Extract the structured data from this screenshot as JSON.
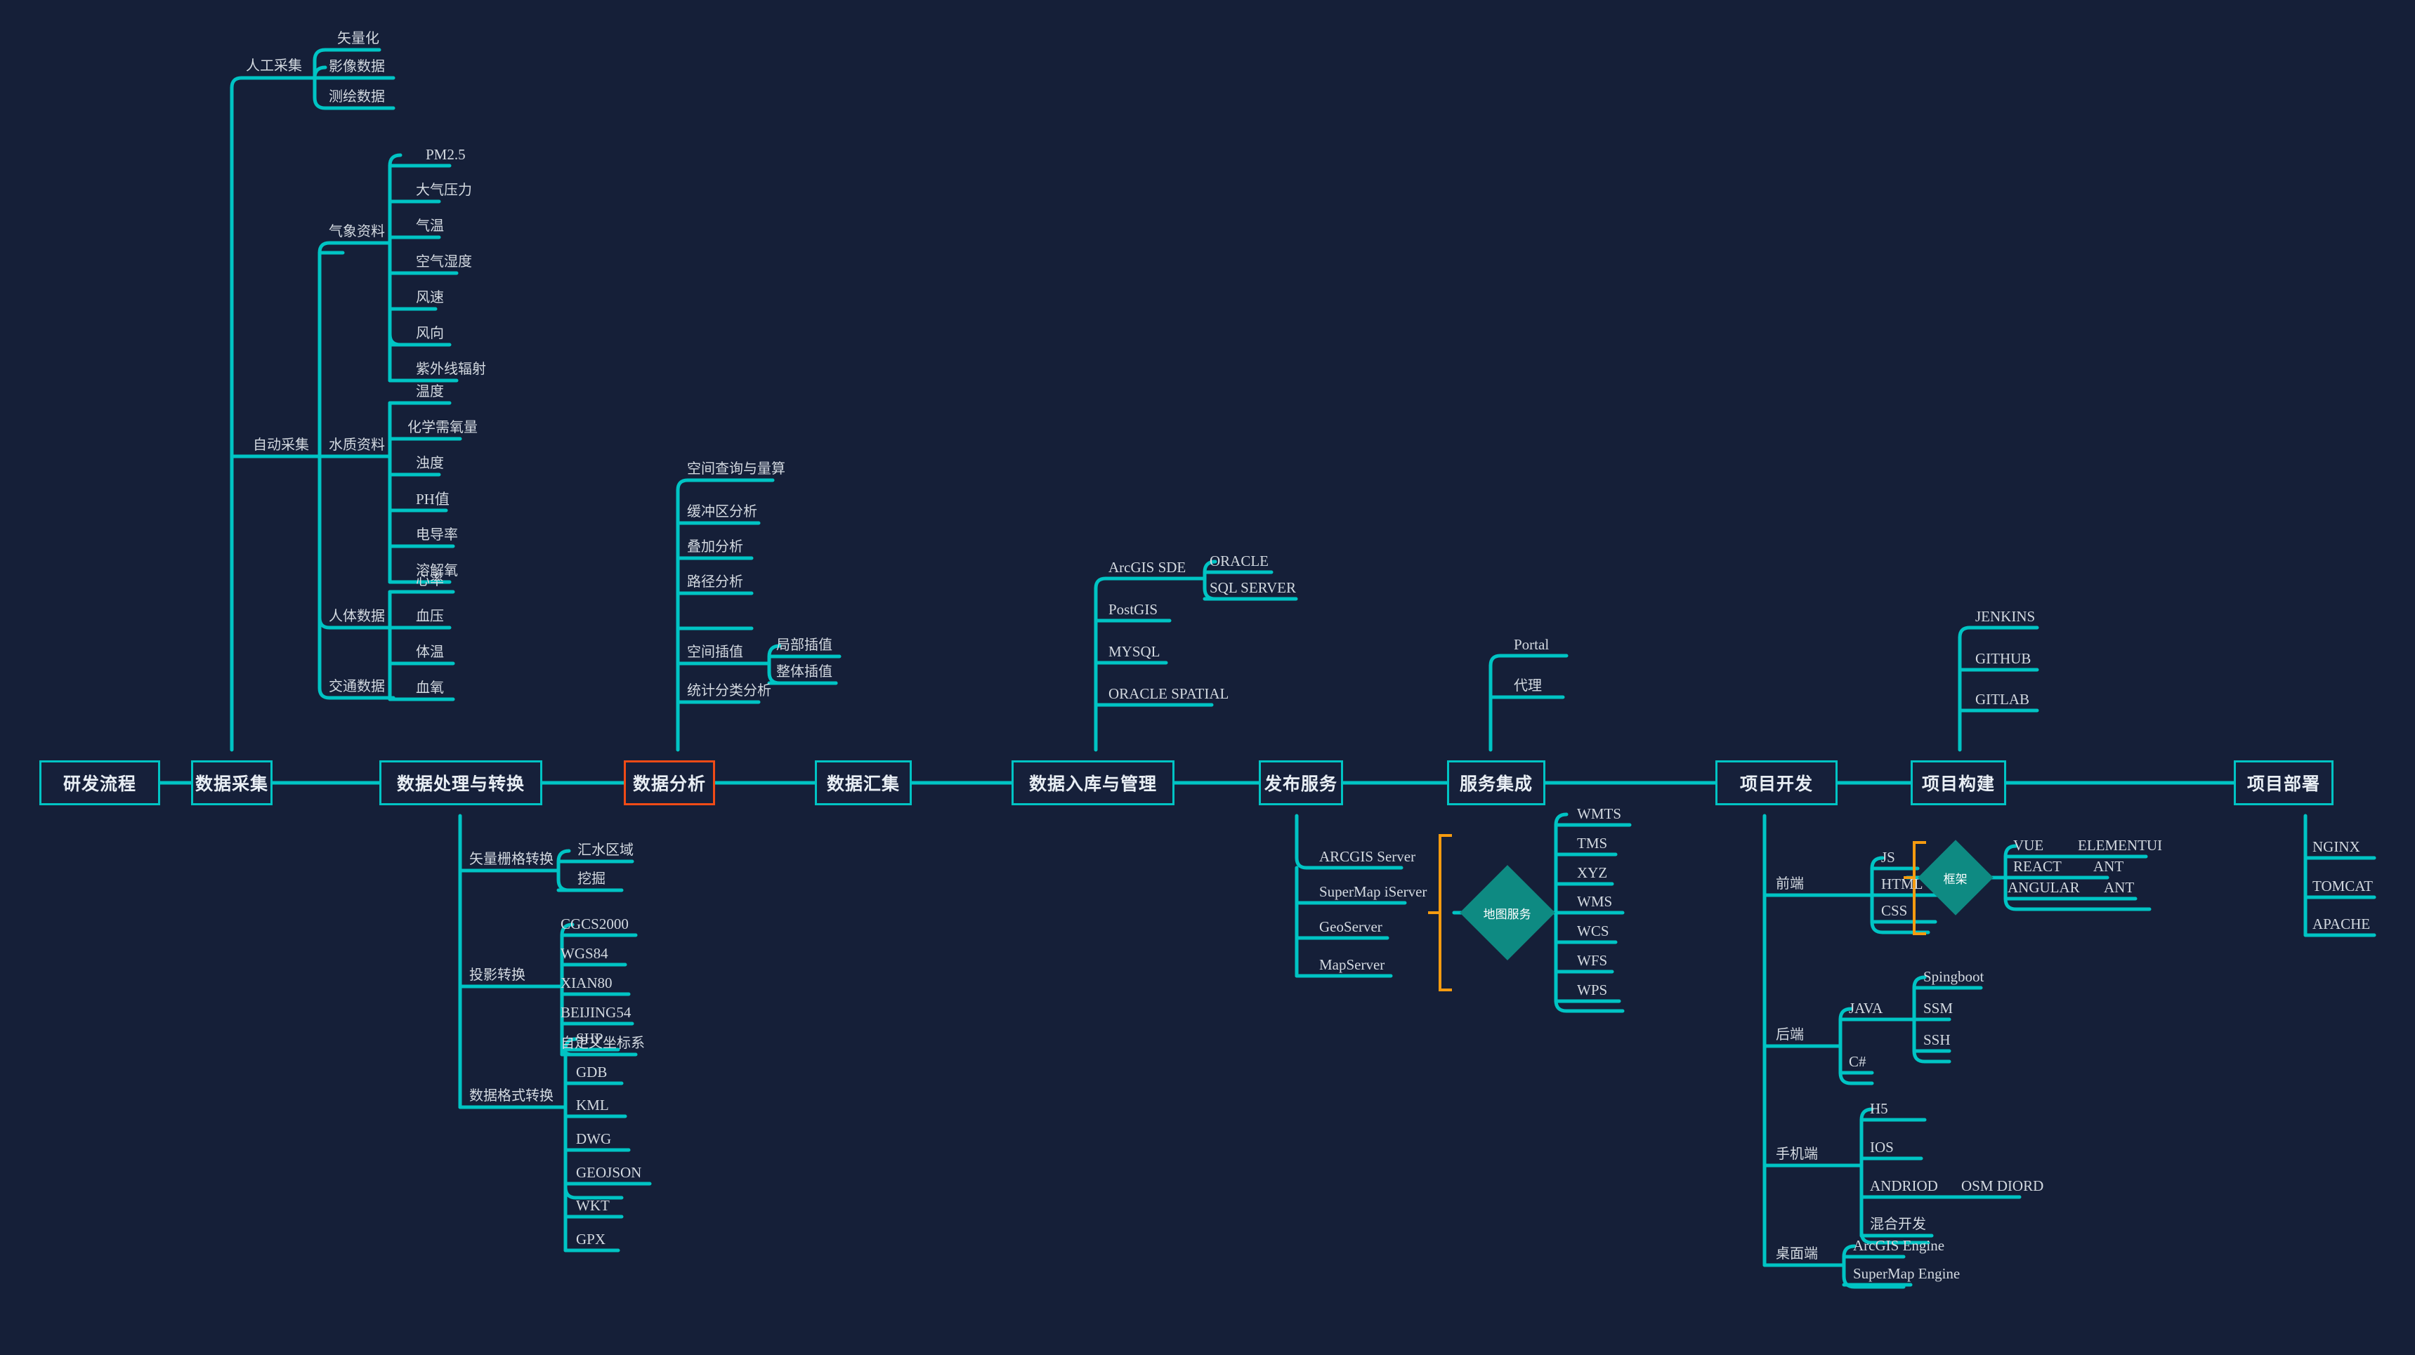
{
  "theme": {
    "background": "#151f38",
    "line": "#00c4c4",
    "line_alt": "#12b2ae",
    "accent": "#f04b16",
    "bracket": "#f59b10",
    "diamond_fill": "#0e8a82",
    "text": "#d3d9e0"
  },
  "spine": {
    "title": "研发流程",
    "stages": [
      "数据采集",
      "数据处理与转换",
      "数据分析",
      "数据汇集",
      "数据入库与管理",
      "发布服务",
      "服务集成",
      "项目开发",
      "项目构建",
      "项目部署"
    ],
    "highlighted": "数据分析"
  },
  "branches": {
    "data_collection": {
      "label": "数据采集",
      "children": [
        {
          "label": "人工采集",
          "children": [
            "矢量化",
            "影像数据",
            "测绘数据"
          ]
        },
        {
          "label": "自动采集",
          "children": [
            {
              "label": "气象资料",
              "children": [
                "PM2.5",
                "大气压力",
                "气温",
                "空气湿度",
                "风速",
                "风向",
                "紫外线辐射"
              ]
            },
            {
              "label": "水质资料",
              "children": [
                "温度",
                "化学需氧量",
                "浊度",
                "PH值",
                "电导率",
                "溶解氧"
              ]
            },
            {
              "label": "人体数据",
              "children": [
                "心率",
                "血压",
                "体温",
                "血氧"
              ]
            },
            {
              "label": "交通数据",
              "children": []
            }
          ]
        }
      ]
    },
    "data_processing": {
      "label": "数据处理与转换",
      "children": [
        {
          "label": "矢量栅格转换",
          "children": [
            "汇水区域",
            "挖掘"
          ]
        },
        {
          "label": "投影转换",
          "children": [
            "CGCS2000",
            "WGS84",
            "XIAN80",
            "BEIJING54",
            "自定义坐标系"
          ]
        },
        {
          "label": "数据格式转换",
          "children": [
            "SHP",
            "GDB",
            "KML",
            "DWG",
            "GEOJSON",
            "WKT",
            "GPX"
          ]
        }
      ]
    },
    "data_analysis": {
      "label": "数据分析",
      "children": [
        {
          "label": "空间查询与量算",
          "children": []
        },
        {
          "label": "缓冲区分析",
          "children": []
        },
        {
          "label": "叠加分析",
          "children": []
        },
        {
          "label": "路径分析",
          "children": []
        },
        {
          "label": "空间插值",
          "children": [
            "局部插值",
            "整体插值"
          ]
        },
        {
          "label": "统计分类分析",
          "children": []
        }
      ]
    },
    "data_storage": {
      "label": "数据入库与管理",
      "children": [
        {
          "label": "ArcGIS SDE",
          "children": [
            "ORACLE",
            "SQL SERVER"
          ]
        },
        {
          "label": "PostGIS",
          "children": []
        },
        {
          "label": "MYSQL",
          "children": []
        },
        {
          "label": "ORACLE SPATIAL",
          "children": []
        }
      ]
    },
    "publish_service": {
      "label": "发布服务",
      "servers": [
        "ARCGIS Server",
        "SuperMap iServer",
        "GeoServer",
        "MapServer"
      ],
      "group_node": "地图服务",
      "outputs": [
        "WMTS",
        "TMS",
        "XYZ",
        "WMS",
        "WCS",
        "WFS",
        "WPS"
      ]
    },
    "service_integration": {
      "label": "服务集成",
      "children": [
        "Portal",
        "代理"
      ]
    },
    "project_dev": {
      "label": "项目开发",
      "frontend": {
        "label": "前端",
        "stack": [
          "JS",
          "HTML",
          "CSS"
        ],
        "group_node": "框架",
        "frameworks": [
          {
            "name": "VUE",
            "ui": "ELEMENTUI"
          },
          {
            "name": "REACT",
            "ui": "ANT"
          },
          {
            "name": "ANGULAR",
            "ui": "ANT"
          }
        ]
      },
      "backend": {
        "label": "后端",
        "children": [
          {
            "label": "JAVA",
            "children": [
              "Spingboot",
              "SSM",
              "SSH"
            ]
          },
          {
            "label": "C#",
            "children": []
          }
        ]
      },
      "mobile": {
        "label": "手机端",
        "children": [
          {
            "label": "H5",
            "children": []
          },
          {
            "label": "IOS",
            "children": []
          },
          {
            "label": "ANDRIOD",
            "children": [
              "OSM DIORD"
            ]
          },
          {
            "label": "混合开发",
            "children": []
          }
        ]
      },
      "desktop": {
        "label": "桌面端",
        "children": [
          "ArcGIS Engine",
          "SuperMap Engine"
        ]
      }
    },
    "project_build": {
      "label": "项目构建",
      "children": [
        "JENKINS",
        "GITHUB",
        "GITLAB"
      ]
    },
    "project_deploy": {
      "label": "项目部署",
      "children": [
        "NGINX",
        "TOMCAT",
        "APACHE"
      ]
    }
  }
}
